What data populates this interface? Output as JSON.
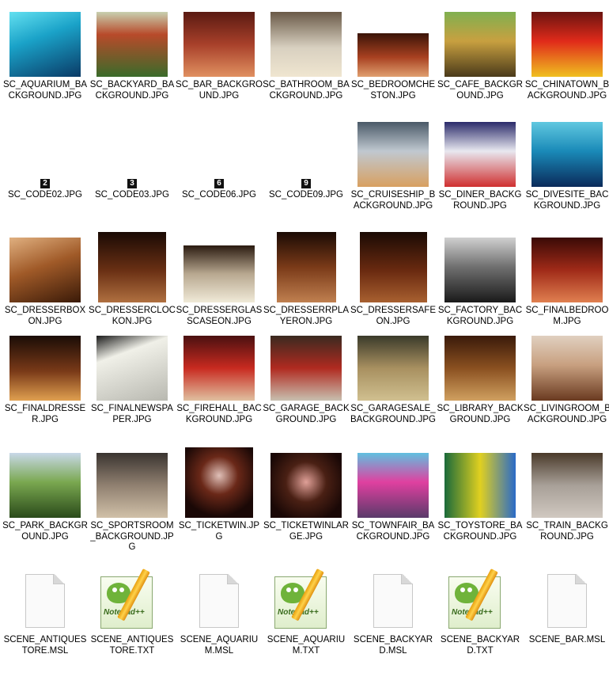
{
  "window": {
    "title": ""
  },
  "items": [
    {
      "name": "SC_AQUARIUM_BACKGROUND.JPG",
      "type": "image",
      "colors": [
        "#0a3a66",
        "#1aa2c8",
        "#63e0f0"
      ]
    },
    {
      "name": "SC_BACKYARD_BACKGROUND.JPG",
      "type": "image",
      "colors": [
        "#3a6b2a",
        "#c8d0b0",
        "#b84a2a"
      ]
    },
    {
      "name": "SC_BAR_BACKGROUND.JPG",
      "type": "image",
      "colors": [
        "#5a1a12",
        "#a8402a",
        "#e09060"
      ]
    },
    {
      "name": "SC_BATHROOM_BACKGROUND.JPG",
      "type": "image",
      "colors": [
        "#6a5a48",
        "#d8d0c0",
        "#f0e6d0"
      ]
    },
    {
      "name": "SC_BEDROOMCHESTON.JPG",
      "type": "image",
      "colors": [
        "#3a1408",
        "#a84020",
        "#e0a070"
      ]
    },
    {
      "name": "SC_CAFE_BACKGROUND.JPG",
      "type": "image",
      "colors": [
        "#4a3a1a",
        "#c8a040",
        "#80b050"
      ]
    },
    {
      "name": "SC_CHINATOWN_BACKGROUND.JPG",
      "type": "image",
      "colors": [
        "#6a1410",
        "#e02a1a",
        "#f0c020"
      ]
    },
    {
      "name": "SC_CODE02.JPG",
      "type": "code",
      "glyph": "2"
    },
    {
      "name": "SC_CODE03.JPG",
      "type": "code",
      "glyph": "3"
    },
    {
      "name": "SC_CODE06.JPG",
      "type": "code",
      "glyph": "6"
    },
    {
      "name": "SC_CODE09.JPG",
      "type": "code",
      "glyph": "9"
    },
    {
      "name": "SC_CRUISESHIP_BACKGROUND.JPG",
      "type": "image",
      "colors": [
        "#4a5a68",
        "#c0c8d0",
        "#d8a060"
      ]
    },
    {
      "name": "SC_DINER_BACKGROUND.JPG",
      "type": "image",
      "colors": [
        "#2a2a6a",
        "#d03030",
        "#e8e8f0"
      ]
    },
    {
      "name": "SC_DIVESITE_BACKGROUND.JPG",
      "type": "image",
      "colors": [
        "#0a2a5a",
        "#1a8ab8",
        "#60c8e0"
      ]
    },
    {
      "name": "SC_DRESSERBOXON.JPG",
      "type": "image",
      "colors": [
        "#3a1a08",
        "#a05a28",
        "#e0b080"
      ]
    },
    {
      "name": "SC_DRESSERCLOCKON.JPG",
      "type": "image",
      "colors": [
        "#1a0a04",
        "#6a3014",
        "#b07040"
      ]
    },
    {
      "name": "SC_DRESSERGLASSCASEON.JPG",
      "type": "image",
      "colors": [
        "#2a1a10",
        "#b8a890",
        "#f0ead8"
      ]
    },
    {
      "name": "SC_DRESSERRPLAYERON.JPG",
      "type": "image",
      "colors": [
        "#1a0a04",
        "#7a3a18",
        "#c08050"
      ]
    },
    {
      "name": "SC_DRESSERSAFEON.JPG",
      "type": "image",
      "colors": [
        "#1a0a04",
        "#6a2a10",
        "#a86030"
      ]
    },
    {
      "name": "SC_FACTORY_BACKGROUND.JPG",
      "type": "image",
      "colors": [
        "#1a1a1a",
        "#707070",
        "#d0d0d0"
      ]
    },
    {
      "name": "SC_FINALBEDROOM.JPG",
      "type": "image",
      "colors": [
        "#3a0a06",
        "#a02a18",
        "#e08050"
      ]
    },
    {
      "name": "SC_FINALDRESSER.JPG",
      "type": "image",
      "colors": [
        "#1a0c06",
        "#7a3a18",
        "#e0a050"
      ]
    },
    {
      "name": "SC_FINALNEWSPAPER.JPG",
      "type": "image",
      "colors": [
        "#1a1a1a",
        "#b8b8b0",
        "#f0f0e8"
      ]
    },
    {
      "name": "SC_FIREHALL_BACKGROUND.JPG",
      "type": "image",
      "colors": [
        "#4a1010",
        "#c82a20",
        "#e0c0a0"
      ]
    },
    {
      "name": "SC_GARAGE_BACKGROUND.JPG",
      "type": "image",
      "colors": [
        "#3a2a20",
        "#b02a20",
        "#c8c0b0"
      ]
    },
    {
      "name": "SC_GARAGESALE_BACKGROUND.JPG",
      "type": "image",
      "colors": [
        "#3a3a2a",
        "#a89060",
        "#d0c090"
      ]
    },
    {
      "name": "SC_LIBRARY_BACKGROUND.JPG",
      "type": "image",
      "colors": [
        "#3a1a0a",
        "#8a5020",
        "#d0a060"
      ]
    },
    {
      "name": "SC_LIVINGROOM_BACKGROUND.JPG",
      "type": "image",
      "colors": [
        "#6a3a20",
        "#c8a080",
        "#e0d0c0"
      ]
    },
    {
      "name": "SC_PARK_BACKGROUND.JPG",
      "type": "image",
      "colors": [
        "#2a4a1a",
        "#7aa850",
        "#c8d8e8"
      ]
    },
    {
      "name": "SC_SPORTSROOM_BACKGROUND.JPG",
      "type": "image",
      "colors": [
        "#3a3430",
        "#908070",
        "#d0c0a8"
      ]
    },
    {
      "name": "SC_TICKETWIN.JPG",
      "type": "image",
      "colors": [
        "#1a0806",
        "#6a2818",
        "#e0c0b8"
      ]
    },
    {
      "name": "SC_TICKETWINLARGE.JPG",
      "type": "image",
      "colors": [
        "#1a0806",
        "#4a2014",
        "#e0a098"
      ]
    },
    {
      "name": "SC_TOWNFAIR_BACKGROUND.JPG",
      "type": "image",
      "colors": [
        "#5a3a6a",
        "#e040a0",
        "#60c0e0"
      ]
    },
    {
      "name": "SC_TOYSTORE_BACKGROUND.JPG",
      "type": "image",
      "colors": [
        "#1a6a3a",
        "#e0d020",
        "#2a6ac8"
      ]
    },
    {
      "name": "SC_TRAIN_BACKGROUND.JPG",
      "type": "image",
      "colors": [
        "#4a3a2a",
        "#a8a098",
        "#d0c8c0"
      ]
    },
    {
      "name": "SCENE_ANTIQUESTORE.MSL",
      "type": "blank"
    },
    {
      "name": "SCENE_ANTIQUESTORE.TXT",
      "type": "notepad"
    },
    {
      "name": "SCENE_AQUARIUM.MSL",
      "type": "blank"
    },
    {
      "name": "SCENE_AQUARIUM.TXT",
      "type": "notepad"
    },
    {
      "name": "SCENE_BACKYARD.MSL",
      "type": "blank"
    },
    {
      "name": "SCENE_BACKYARD.TXT",
      "type": "notepad"
    },
    {
      "name": "SCENE_BAR.MSL",
      "type": "blank"
    }
  ],
  "notepad_brand": "Notepad++"
}
